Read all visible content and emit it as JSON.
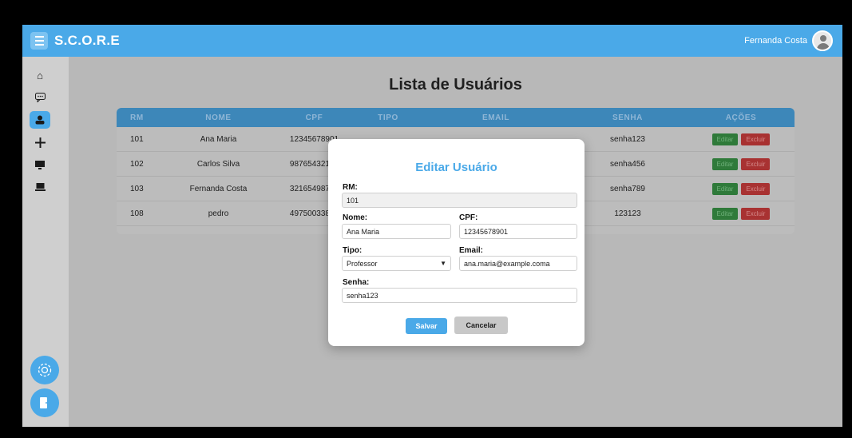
{
  "header": {
    "brand": "S.C.O.R.E",
    "user_name": "Fernanda Costa"
  },
  "sidebar": {
    "items": [
      {
        "icon": "home-icon",
        "glyph": "⌂"
      },
      {
        "icon": "chat-icon",
        "glyph": "💬"
      },
      {
        "icon": "users-icon",
        "glyph": "👥"
      },
      {
        "icon": "add-icon",
        "glyph": "✚"
      },
      {
        "icon": "monitor-icon",
        "glyph": "▬"
      },
      {
        "icon": "laptop-icon",
        "glyph": "▭"
      }
    ],
    "settings_icon": "gear-icon",
    "logout_icon": "logout-icon"
  },
  "page": {
    "title": "Lista de Usuários"
  },
  "table": {
    "headers": [
      "RM",
      "NOME",
      "CPF",
      "TIPO",
      "EMAIL",
      "SENHA",
      "AÇÕES"
    ],
    "rows": [
      {
        "rm": "101",
        "nome": "Ana Maria",
        "cpf": "12345678901",
        "senha": "senha123"
      },
      {
        "rm": "102",
        "nome": "Carlos Silva",
        "cpf": "98765432100",
        "senha": "senha456"
      },
      {
        "rm": "103",
        "nome": "Fernanda Costa",
        "cpf": "32165498700",
        "senha": "senha789"
      },
      {
        "rm": "108",
        "nome": "pedro",
        "cpf": "49750033841",
        "senha": "123123"
      }
    ],
    "edit_label": "Editar",
    "delete_label": "Excluir"
  },
  "modal": {
    "title": "Editar Usuário",
    "rm_label": "RM:",
    "rm_value": "101",
    "nome_label": "Nome:",
    "nome_value": "Ana Maria",
    "cpf_label": "CPF:",
    "cpf_value": "12345678901",
    "tipo_label": "Tipo:",
    "tipo_value": "Professor",
    "email_label": "Email:",
    "email_value": "ana.maria@example.coma",
    "senha_label": "Senha:",
    "senha_value": "senha123",
    "save_label": "Salvar",
    "cancel_label": "Cancelar"
  },
  "colors": {
    "primary": "#4aa9e8",
    "table_header": "#3d87b9",
    "edit": "#2f7a3a",
    "delete": "#a83232"
  }
}
